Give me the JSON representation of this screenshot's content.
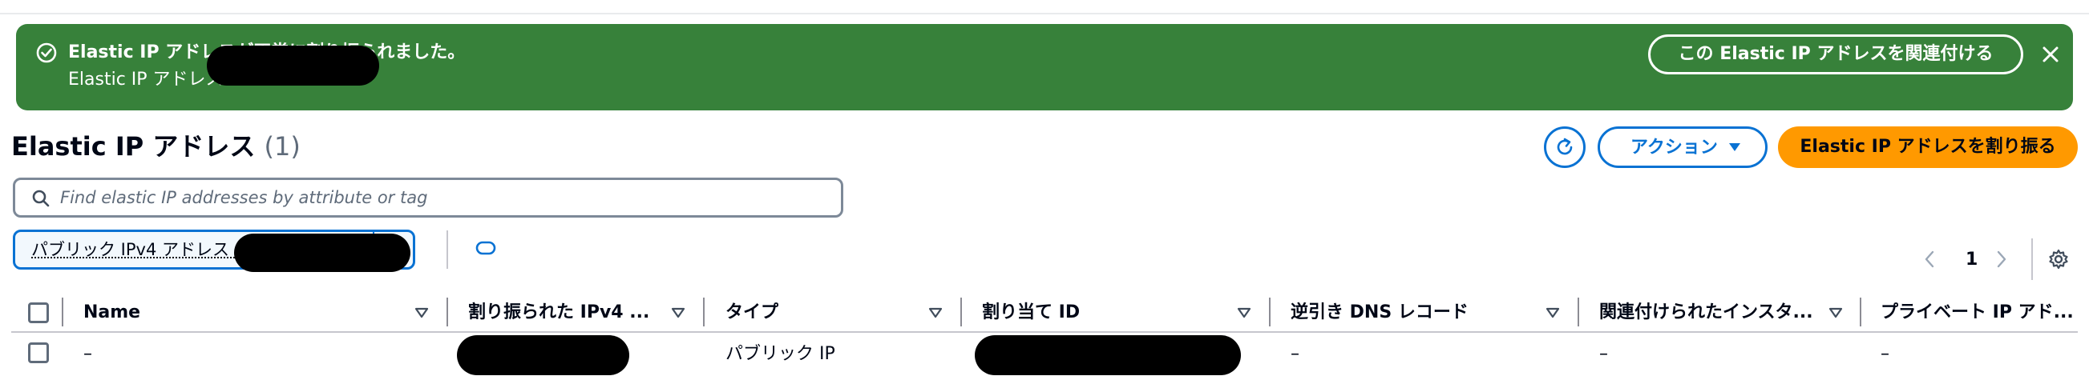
{
  "flash": {
    "title": "Elastic IP アドレスが正常に割り振られました。",
    "subtitle": "Elastic IP アドレス",
    "associate_label": "この Elastic IP アドレスを関連付ける",
    "color": "#37813a"
  },
  "header": {
    "title": "Elastic IP アドレス",
    "count": "(1)",
    "actions_label": "アクション",
    "allocate_label": "Elastic IP アドレスを割り振る",
    "primary_color": "#ff9900",
    "link_color": "#0972d3"
  },
  "search": {
    "placeholder": "Find elastic IP addresses by attribute or tag"
  },
  "filter": {
    "token_label": "パブリック IPv4 アドレス :"
  },
  "pagination": {
    "current_page": "1"
  },
  "table": {
    "columns": [
      "Name",
      "割り振られた IPv4 ...",
      "タイプ",
      "割り当て ID",
      "逆引き DNS レコード",
      "関連付けられたインスタ...",
      "プライベート IP アド..."
    ],
    "rows": [
      {
        "name": "–",
        "type": "パブリック IP",
        "reverse_dns": "–",
        "instance": "–",
        "private_ip": "–"
      }
    ]
  }
}
